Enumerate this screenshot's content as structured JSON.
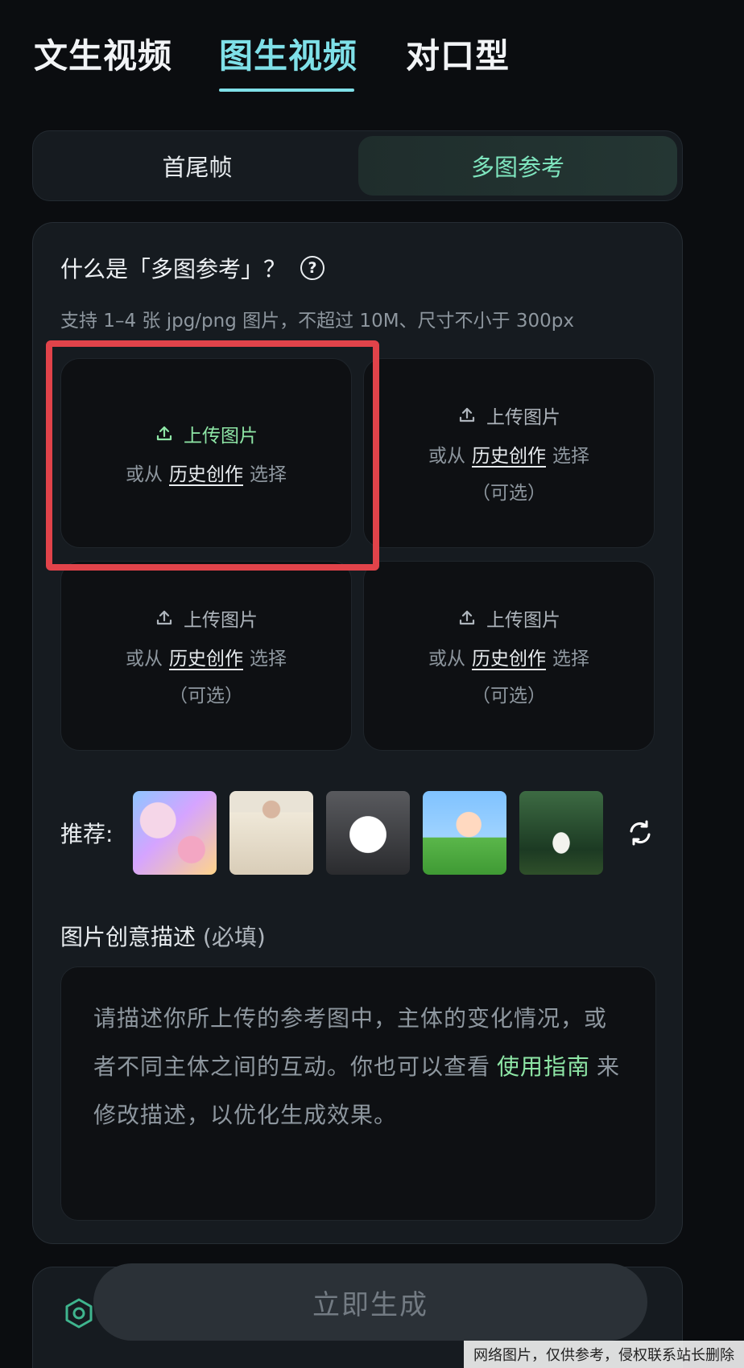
{
  "top_tabs": [
    {
      "label": "文生视频"
    },
    {
      "label": "图生视频",
      "active": true
    },
    {
      "label": "对口型"
    }
  ],
  "segmented": {
    "left": "首尾帧",
    "right": "多图参考",
    "active": "right"
  },
  "card": {
    "title": "什么是「多图参考」？",
    "help_icon": "?",
    "description": "支持 1–4 张 jpg/png 图片，不超过 10M、尺寸不小于 300px"
  },
  "slots": [
    {
      "upload": "上传图片",
      "prefix": "或从",
      "link": "历史创作",
      "suffix": "选择",
      "optional": ""
    },
    {
      "upload": "上传图片",
      "prefix": "或从",
      "link": "历史创作",
      "suffix": "选择",
      "optional": "（可选）"
    },
    {
      "upload": "上传图片",
      "prefix": "或从",
      "link": "历史创作",
      "suffix": "选择",
      "optional": "（可选）"
    },
    {
      "upload": "上传图片",
      "prefix": "或从",
      "link": "历史创作",
      "suffix": "选择",
      "optional": "（可选）"
    }
  ],
  "recommend": {
    "label": "推荐:",
    "thumbnails": [
      "cat-image",
      "woman-image",
      "puppy-image",
      "toy-character-image",
      "forest-woman-image"
    ]
  },
  "description_section": {
    "label": "图片创意描述",
    "required": "(必填)",
    "placeholder_part1": "请描述你所上传的参考图中，主体的变化情况，或者不同主体之间的互动。你也可以查看",
    "guide_link": "使用指南",
    "placeholder_part2": "来修改描述，以优化生成效果。"
  },
  "generate_button": "立即生成",
  "watermark": "网络图片，仅供参考，侵权联系站长删除",
  "colors": {
    "accent_teal": "#7fe0e8",
    "accent_green": "#8ee6a6",
    "highlight_red": "#e1434a",
    "background": "#0b0d10"
  }
}
